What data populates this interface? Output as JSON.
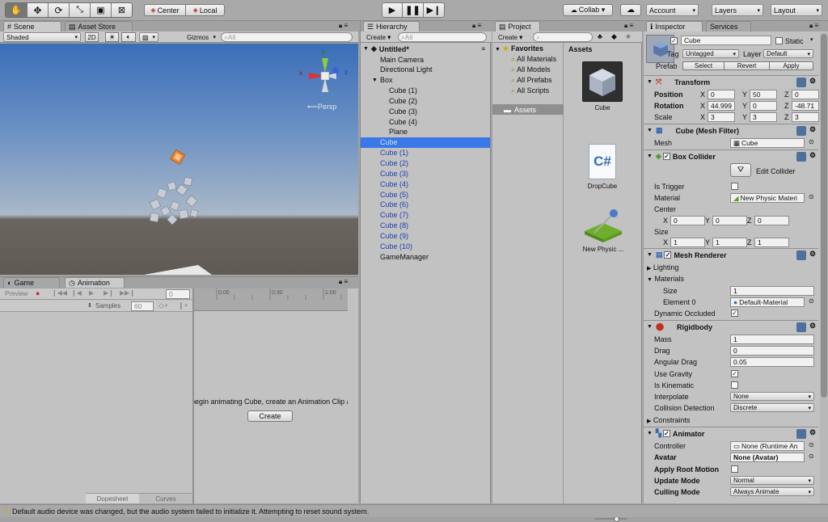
{
  "toolbar": {
    "tools": [
      "hand-tool-icon",
      "move-tool-icon",
      "rotate-tool-icon",
      "scale-tool-icon",
      "rect-tool-icon",
      "transform-tool-icon"
    ],
    "pivot": "Center",
    "space": "Local",
    "collab": "Collab ▾",
    "account": "Account",
    "layers": "Layers",
    "layout": "Layout"
  },
  "scene": {
    "tab_scene": "Scene",
    "tab_store": "Asset Store",
    "shading": "Shaded",
    "mode2d": "2D",
    "gizmos": "Gizmos",
    "search_placeholder": "All",
    "persp": "Persp",
    "axis_x": "x",
    "axis_y": "y",
    "axis_z": "z"
  },
  "animation": {
    "tab_game": "Game",
    "tab_anim": "Animation",
    "preview": "Preview",
    "frame": "0",
    "samples_label": "Samples",
    "samples": "60",
    "t0": "0:00",
    "t1": "0:30",
    "t2": "1:00",
    "message": "To begin animating Cube, create an Animation Clip and an Animator.",
    "create": "Create",
    "dopesheet": "Dopesheet",
    "curves": "Curves"
  },
  "hierarchy": {
    "tab": "Hierarchy",
    "create": "Create ▾",
    "search_placeholder": "All",
    "scene": "Untitled*",
    "items": [
      {
        "label": "Main Camera",
        "indent": 1,
        "blue": false,
        "sel": false
      },
      {
        "label": "Directional Light",
        "indent": 1,
        "blue": false,
        "sel": false
      },
      {
        "label": "Box",
        "indent": 1,
        "blue": false,
        "sel": false,
        "fold": true
      },
      {
        "label": "Cube (1)",
        "indent": 2,
        "blue": false,
        "sel": false
      },
      {
        "label": "Cube (2)",
        "indent": 2,
        "blue": false,
        "sel": false
      },
      {
        "label": "Cube (3)",
        "indent": 2,
        "blue": false,
        "sel": false
      },
      {
        "label": "Cube (4)",
        "indent": 2,
        "blue": false,
        "sel": false
      },
      {
        "label": "Plane",
        "indent": 2,
        "blue": false,
        "sel": false
      },
      {
        "label": "Cube",
        "indent": 1,
        "blue": true,
        "sel": true
      },
      {
        "label": "Cube (1)",
        "indent": 1,
        "blue": true,
        "sel": false
      },
      {
        "label": "Cube (2)",
        "indent": 1,
        "blue": true,
        "sel": false
      },
      {
        "label": "Cube (3)",
        "indent": 1,
        "blue": true,
        "sel": false
      },
      {
        "label": "Cube (4)",
        "indent": 1,
        "blue": true,
        "sel": false
      },
      {
        "label": "Cube (5)",
        "indent": 1,
        "blue": true,
        "sel": false
      },
      {
        "label": "Cube (6)",
        "indent": 1,
        "blue": true,
        "sel": false
      },
      {
        "label": "Cube (7)",
        "indent": 1,
        "blue": true,
        "sel": false
      },
      {
        "label": "Cube (8)",
        "indent": 1,
        "blue": true,
        "sel": false
      },
      {
        "label": "Cube (9)",
        "indent": 1,
        "blue": true,
        "sel": false
      },
      {
        "label": "Cube (10)",
        "indent": 1,
        "blue": true,
        "sel": false
      },
      {
        "label": "GameManager",
        "indent": 1,
        "blue": false,
        "sel": false
      }
    ]
  },
  "project": {
    "tab": "Project",
    "create": "Create ▾",
    "favorites": "Favorites",
    "fav_items": [
      "All Materials",
      "All Models",
      "All Prefabs",
      "All Scripts"
    ],
    "assets_folder": "Assets",
    "assets_header": "Assets",
    "assets": [
      "Cube",
      "DropCube",
      "New Physic ..."
    ]
  },
  "inspector": {
    "tab": "Inspector",
    "tab_services": "Services",
    "name": "Cube",
    "static": "Static",
    "tag_label": "Tag",
    "tag": "Untagged",
    "layer_label": "Layer",
    "layer": "Default",
    "prefab_label": "Prefab",
    "prefab_select": "Select",
    "prefab_revert": "Revert",
    "prefab_apply": "Apply",
    "transform": {
      "title": "Transform",
      "position": "Position",
      "rotation": "Rotation",
      "scale": "Scale",
      "pos": [
        "0",
        "50",
        "0"
      ],
      "rot": [
        "44.999",
        "0",
        "-48.71"
      ],
      "scl": [
        "3",
        "3",
        "3"
      ]
    },
    "meshfilter": {
      "title": "Cube (Mesh Filter)",
      "mesh_label": "Mesh",
      "mesh": "Cube"
    },
    "boxcollider": {
      "title": "Box Collider",
      "edit": "Edit Collider",
      "is_trigger": "Is Trigger",
      "material_label": "Material",
      "material": "New Physic Materi",
      "center": "Center",
      "center_v": [
        "0",
        "0",
        "0"
      ],
      "size": "Size",
      "size_v": [
        "1",
        "1",
        "1"
      ]
    },
    "meshrenderer": {
      "title": "Mesh Renderer",
      "lighting": "Lighting",
      "materials": "Materials",
      "size_label": "Size",
      "size": "1",
      "element0_label": "Element 0",
      "element0": "Default-Material",
      "dynamic": "Dynamic Occluded"
    },
    "rigidbody": {
      "title": "Rigidbody",
      "mass_label": "Mass",
      "mass": "1",
      "drag_label": "Drag",
      "drag": "0",
      "adrag_label": "Angular Drag",
      "adrag": "0.05",
      "gravity": "Use Gravity",
      "kinematic": "Is Kinematic",
      "interp_label": "Interpolate",
      "interp": "None",
      "coll_label": "Collision Detection",
      "coll": "Discrete",
      "constraints": "Constraints"
    },
    "animator": {
      "title": "Animator",
      "controller_label": "Controller",
      "controller": "None (Runtime An",
      "avatar_label": "Avatar",
      "avatar": "None (Avatar)",
      "rootmotion": "Apply Root Motion",
      "update_label": "Update Mode",
      "update": "Normal",
      "culling_label": "Culling Mode",
      "culling": "Always Animate"
    }
  },
  "status": {
    "message": "Default audio device was changed, but the audio system failed to initialize it. Attempting to reset sound system."
  }
}
